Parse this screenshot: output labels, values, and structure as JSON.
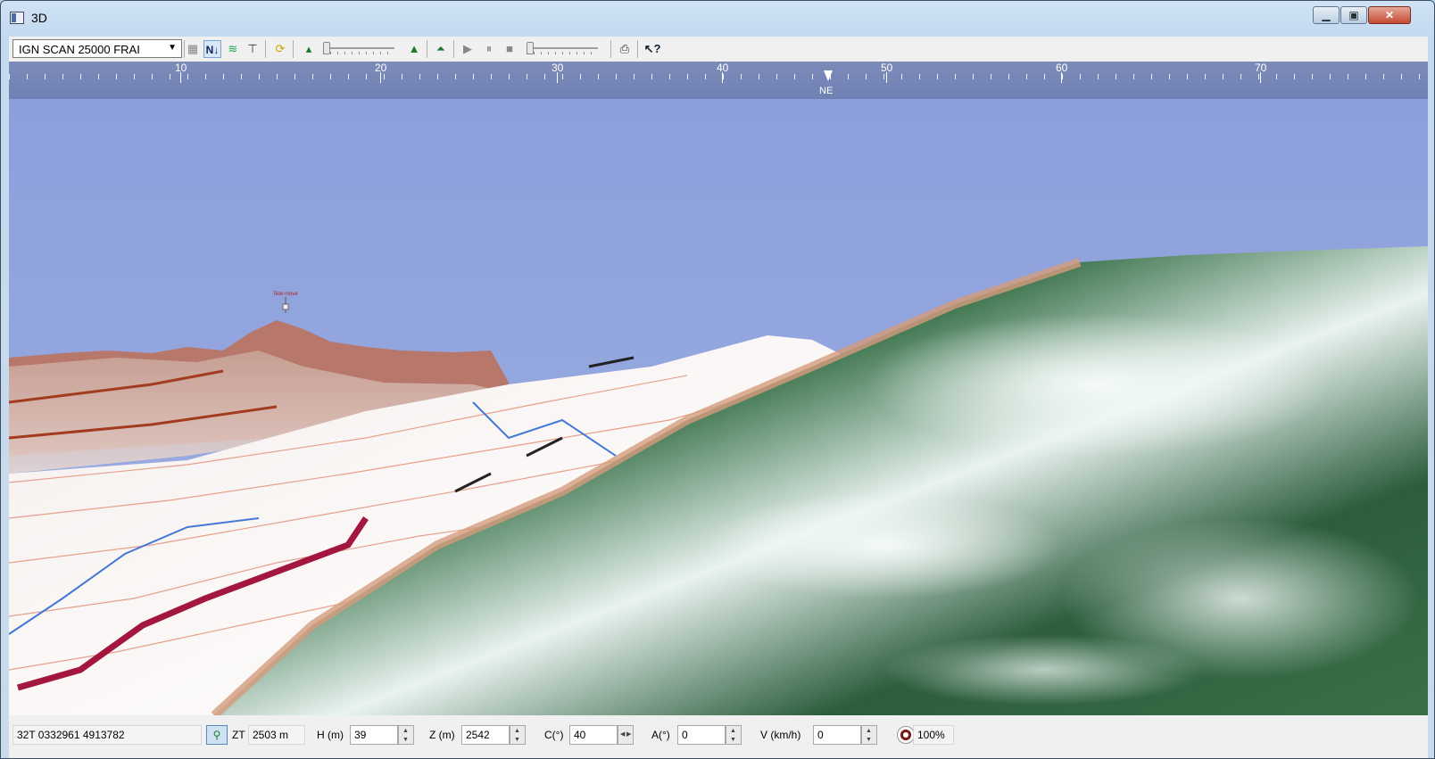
{
  "window": {
    "title": "3D",
    "min_label": "▁",
    "max_label": "▣",
    "close_label": "✕"
  },
  "toolbar": {
    "map_layer": "IGN SCAN 25000 FRAI",
    "north_label": "N↓",
    "icons": [
      "map-icon",
      "north-up-icon",
      "profile-icon",
      "pin-tool-icon",
      "refresh-icon",
      "terrain-low-icon",
      "terrain-high-icon",
      "terrain-icon",
      "play-icon",
      "pause-icon",
      "stop-icon",
      "print-icon",
      "help-icon"
    ]
  },
  "ruler": {
    "labels": [
      "10",
      "20",
      "30",
      "40",
      "50",
      "60",
      "70"
    ],
    "heading": "NE"
  },
  "viewport": {
    "peak_label": "Tete move"
  },
  "status": {
    "coords": "32T  0332961  4913782",
    "zt_label": "ZT",
    "zt_value": "2503 m",
    "h_label": "H (m)",
    "h_value": "39",
    "z_label": "Z (m)",
    "z_value": "2542",
    "c_label": "C(°)",
    "c_value": "40",
    "a_label": "A(°)",
    "a_value": "0",
    "v_label": "V (km/h)",
    "v_value": "0",
    "zoom": "100%"
  }
}
